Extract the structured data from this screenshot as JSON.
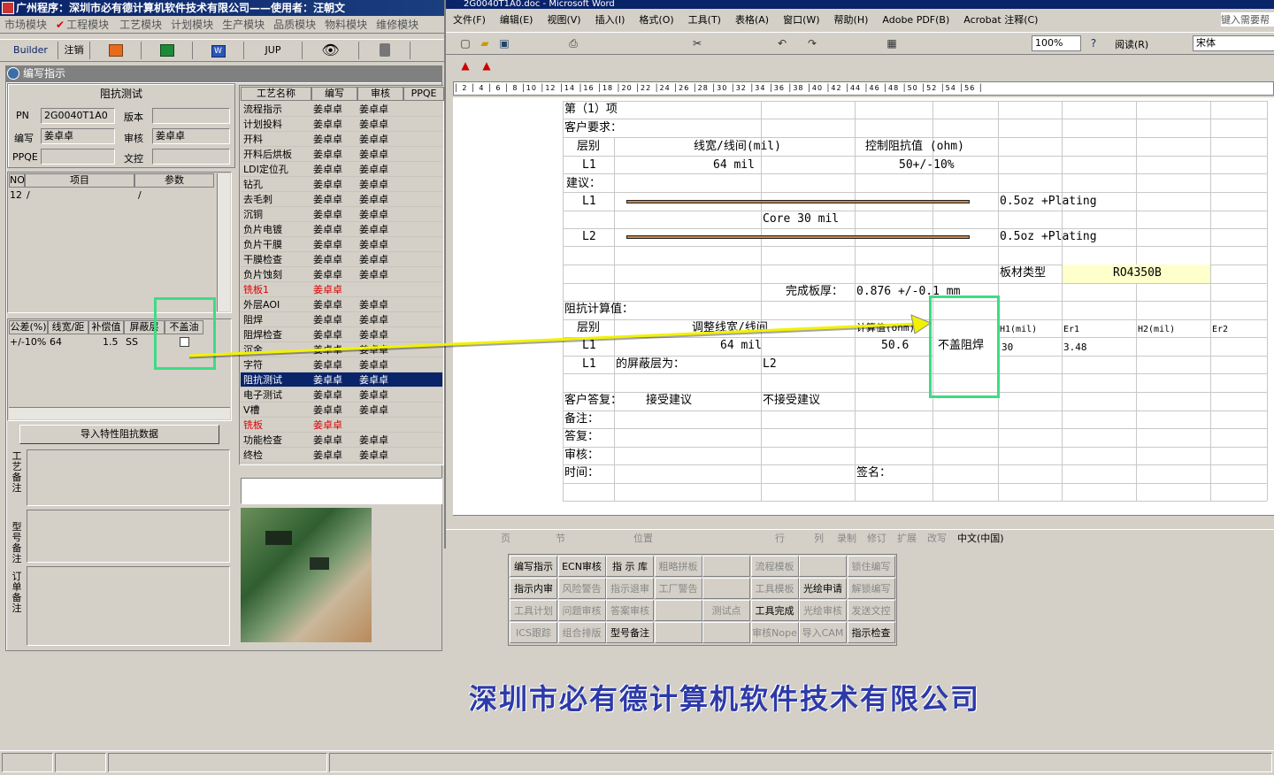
{
  "app": {
    "title": "广州程序：深圳市必有德计算机软件技术有限公司——使用者：汪朝文",
    "menu": [
      "市场模块",
      "工程模块",
      "工艺模块",
      "计划模块",
      "生产模块",
      "品质模块",
      "物料模块",
      "维修模块"
    ],
    "toolbar": {
      "builder": "Builder",
      "logout": "注销",
      "jup": "JUP"
    },
    "panel_title": "编写指示"
  },
  "left": {
    "group_title": "阻抗测试",
    "pn_label": "PN",
    "pn_value": "2G0040T1A0",
    "version_label": "版本",
    "version_value": "",
    "writer_label": "编写",
    "writer_value": "姜卓卓",
    "audit_label": "审核",
    "audit_value": "姜卓卓",
    "ppqe_label": "PPQE",
    "ppqe_value": "",
    "doc_label": "文控",
    "doc_value": "",
    "items_headers": [
      "NO",
      "项目",
      "参数"
    ],
    "items_row": [
      "12",
      "/",
      "/"
    ],
    "imp_headers": [
      "公差(%)",
      "线宽/距",
      "补偿值",
      "屏蔽层",
      "不盖油"
    ],
    "imp_row": [
      "+/-10%",
      "64",
      "1.5",
      "SS"
    ],
    "import_button": "导入特性阻抗数据",
    "remark_labels": [
      "工艺备注",
      "型号备注",
      "订单备注"
    ]
  },
  "flow": {
    "headers": [
      "工艺名称",
      "编写",
      "审核",
      "PPQE"
    ],
    "rows": [
      {
        "name": "流程指示",
        "writer": "姜卓卓",
        "audit": "姜卓卓"
      },
      {
        "name": "计划投料",
        "writer": "姜卓卓",
        "audit": "姜卓卓"
      },
      {
        "name": "开料",
        "writer": "姜卓卓",
        "audit": "姜卓卓"
      },
      {
        "name": "开料后烘板",
        "writer": "姜卓卓",
        "audit": "姜卓卓"
      },
      {
        "name": "LDI定位孔",
        "writer": "姜卓卓",
        "audit": "姜卓卓"
      },
      {
        "name": "钻孔",
        "writer": "姜卓卓",
        "audit": "姜卓卓"
      },
      {
        "name": "去毛刺",
        "writer": "姜卓卓",
        "audit": "姜卓卓"
      },
      {
        "name": "沉铜",
        "writer": "姜卓卓",
        "audit": "姜卓卓"
      },
      {
        "name": "负片电镀",
        "writer": "姜卓卓",
        "audit": "姜卓卓"
      },
      {
        "name": "负片干膜",
        "writer": "姜卓卓",
        "audit": "姜卓卓"
      },
      {
        "name": "干膜检查",
        "writer": "姜卓卓",
        "audit": "姜卓卓"
      },
      {
        "name": "负片蚀刻",
        "writer": "姜卓卓",
        "audit": "姜卓卓"
      },
      {
        "name": "铣板1",
        "writer": "姜卓卓",
        "audit": ""
      },
      {
        "name": "外层AOI",
        "writer": "姜卓卓",
        "audit": "姜卓卓"
      },
      {
        "name": "阻焊",
        "writer": "姜卓卓",
        "audit": "姜卓卓"
      },
      {
        "name": "阻焊检查",
        "writer": "姜卓卓",
        "audit": "姜卓卓"
      },
      {
        "name": "沉金",
        "writer": "姜卓卓",
        "audit": "姜卓卓"
      },
      {
        "name": "字符",
        "writer": "姜卓卓",
        "audit": "姜卓卓"
      },
      {
        "name": "阻抗测试",
        "writer": "姜卓卓",
        "audit": "姜卓卓"
      },
      {
        "name": "电子测试",
        "writer": "姜卓卓",
        "audit": "姜卓卓"
      },
      {
        "name": "V槽",
        "writer": "姜卓卓",
        "audit": "姜卓卓"
      },
      {
        "name": "铣板",
        "writer": "姜卓卓",
        "audit": ""
      },
      {
        "name": "功能检查",
        "writer": "姜卓卓",
        "audit": "姜卓卓"
      },
      {
        "name": "终检",
        "writer": "姜卓卓",
        "audit": "姜卓卓"
      }
    ]
  },
  "word": {
    "title": "2G0040T1A0.doc - Microsoft Word",
    "menu": [
      "文件(F)",
      "编辑(E)",
      "视图(V)",
      "插入(I)",
      "格式(O)",
      "工具(T)",
      "表格(A)",
      "窗口(W)",
      "帮助(H)",
      "Adobe PDF(B)",
      "Acrobat 注释(C)"
    ],
    "help_placeholder": "键入需要帮",
    "zoom": "100%",
    "read_label": "阅读(R)",
    "font_name": "宋体",
    "status": [
      "页",
      "节",
      "位置",
      "行",
      "列",
      "录制",
      "修订",
      "扩展",
      "改写",
      "中文(中国)"
    ]
  },
  "doc": {
    "item": "第（1）项",
    "customer_req": "客户要求：",
    "layer": "层别",
    "line_width": "线宽/线间(mil)",
    "control_imp": "控制阻抗值 (ohm)",
    "l1": "L1",
    "l1_width": "64 mil",
    "l1_imp": "50+/-10%",
    "suggest": "建议：",
    "l1b": "L1",
    "l1_copper": "0.5oz +Plating",
    "core": "Core   30 mil",
    "l2": "L2",
    "l2_copper": "0.5oz +Plating",
    "board_type_label": "板材类型",
    "board_type": "RO4350B",
    "thickness_label": "完成板厚：",
    "thickness": "0.876 +/-0.1 mm",
    "calc_title": "阻抗计算值：",
    "calc_layer": "层别",
    "adjust_width": "调整线宽/线间",
    "calc_value": "计算值(ohm)",
    "no_mask": "不盖阻焊",
    "h1": "H1(mil)",
    "er1": "Er1",
    "h2": "H2(mil)",
    "er2": "Er2",
    "calc_l1": "L1",
    "calc_width": "64 mil",
    "calc_result": "50.6",
    "h1_value": "30",
    "er1_value": "3.48",
    "shield_l1": "L1",
    "shield_text": "的屏蔽层为：",
    "shield_l2": "L2",
    "cust_answer": "客户答复：",
    "accept": "接受建议",
    "reject": "不接受建议",
    "note": "备注：",
    "reply": "答复：",
    "review": "审核：",
    "time": "时间：",
    "sign": "签名："
  },
  "modules": [
    [
      "编写指示",
      "ECN审核",
      "指 示 库",
      "粗略拼板",
      "",
      "流程模板",
      "",
      "锁住编写"
    ],
    [
      "指示内审",
      "风险警告",
      "指示退审",
      "工厂警告",
      "",
      "工具模板",
      "光绘申请",
      "解锁编写"
    ],
    [
      "工具计划",
      "问题审核",
      "答案审核",
      "",
      "测试点",
      "工具完成",
      "光绘审核",
      "发送文控"
    ],
    [
      "ICS跟踪",
      "组合排版",
      "型号备注",
      "",
      "",
      "审核Nope",
      "导入CAM",
      "指示检查"
    ]
  ],
  "modules_dim": [
    [
      false,
      false,
      false,
      true,
      false,
      true,
      false,
      true
    ],
    [
      false,
      true,
      true,
      true,
      false,
      true,
      false,
      true
    ],
    [
      true,
      true,
      true,
      false,
      true,
      false,
      true,
      true
    ],
    [
      true,
      true,
      false,
      false,
      false,
      true,
      true,
      false
    ]
  ],
  "company": "深圳市必有德计算机软件技术有限公司",
  "colors": {
    "highlight": "#3ddc84",
    "arrow": "#f2f200",
    "selection": "#0a246a"
  }
}
